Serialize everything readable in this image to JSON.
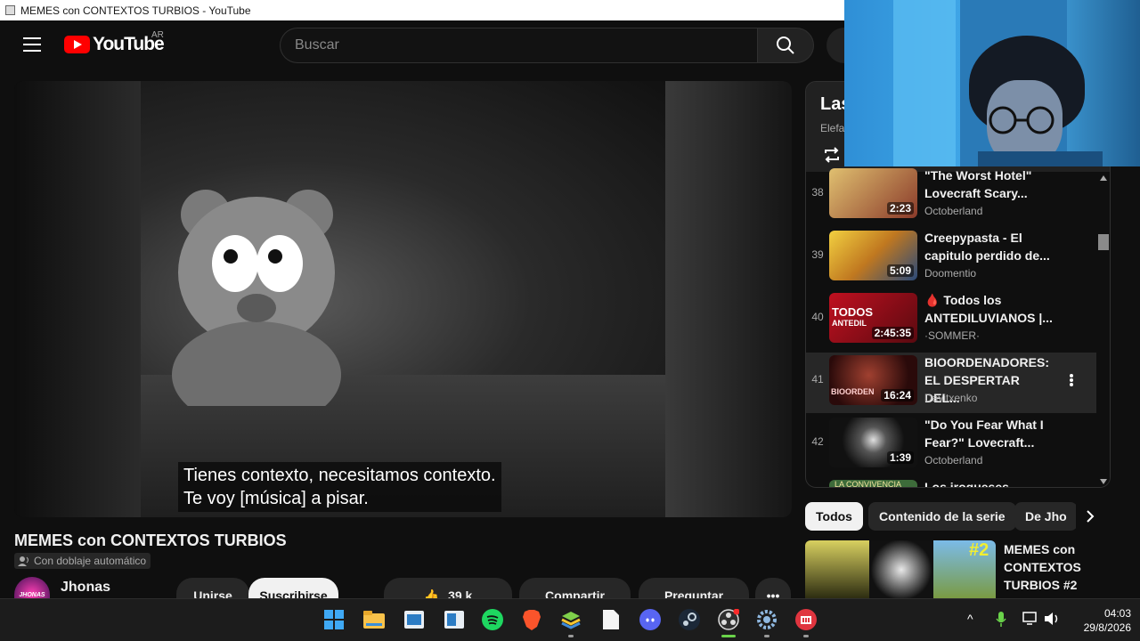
{
  "window": {
    "title": "MEMES con CONTEXTOS TURBIOS - YouTube"
  },
  "header": {
    "logo_text": "YouTube",
    "region": "AR",
    "search_placeholder": "Buscar"
  },
  "player": {
    "caption_line1": "Tienes contexto, necesitamos contexto.",
    "caption_line2": "Te voy [música] a pisar."
  },
  "video": {
    "title": "MEMES con CONTEXTOS TURBIOS",
    "dub_badge": "Con doblaje automático",
    "channel_name": "Jhonas",
    "channel_avatar_text": "JHONAS",
    "join_label": "Unirse",
    "subscribe_label": "Suscribirse",
    "like_count": "39 k",
    "share_label": "Compartir",
    "ask_label": "Preguntar"
  },
  "playlist": {
    "title_partial": "Las",
    "subtitle_partial": "Elefa",
    "items": [
      {
        "index": "38",
        "title": "\"The Worst Hotel\" Lovecraft Scary...",
        "channel": "Octoberland",
        "duration": "2:23",
        "thumb_color": "#b88a3a"
      },
      {
        "index": "39",
        "title": "Creepypasta - El capitulo perdido de...",
        "channel": "Doomentio",
        "duration": "5:09",
        "thumb_color": "#e8b830"
      },
      {
        "index": "40",
        "title": "🩸 Todos los ANTEDILUVIANOS |...",
        "channel": "·SOMMER·",
        "duration": "2:45:35",
        "thumb_color": "#a01018",
        "thumb_text1": "TODOS",
        "thumb_text2": "ANTEDIL"
      },
      {
        "index": "41",
        "title": "BIOORDENADORES: EL DESPERTAR DEL...",
        "channel": "Davitxenko",
        "duration": "16:24",
        "thumb_color": "#4a1a1a",
        "thumb_text1": "BIOORDEN"
      },
      {
        "index": "42",
        "title": "\"Do You Fear What I Fear?\" Lovecraft...",
        "channel": "Octoberland",
        "duration": "1:39",
        "thumb_color": "#1a1a1a"
      },
      {
        "index": "",
        "title": "Los iroqueses -",
        "channel": "",
        "duration": "",
        "thumb_color": "#3d6b3a",
        "thumb_text1": "LA CONVIVENCIA"
      }
    ]
  },
  "chips": [
    "Todos",
    "Contenido de la serie",
    "De Jho"
  ],
  "recommendation": {
    "title": "MEMES con CONTEXTOS TURBIOS #2",
    "badge": "#2"
  },
  "taskbar": {
    "time": "04:03",
    "date": "29/8/2026"
  },
  "colors": {
    "brand_red": "#ff0000",
    "background": "#0f0f0f",
    "chip_selected": "#f1f1f1"
  }
}
